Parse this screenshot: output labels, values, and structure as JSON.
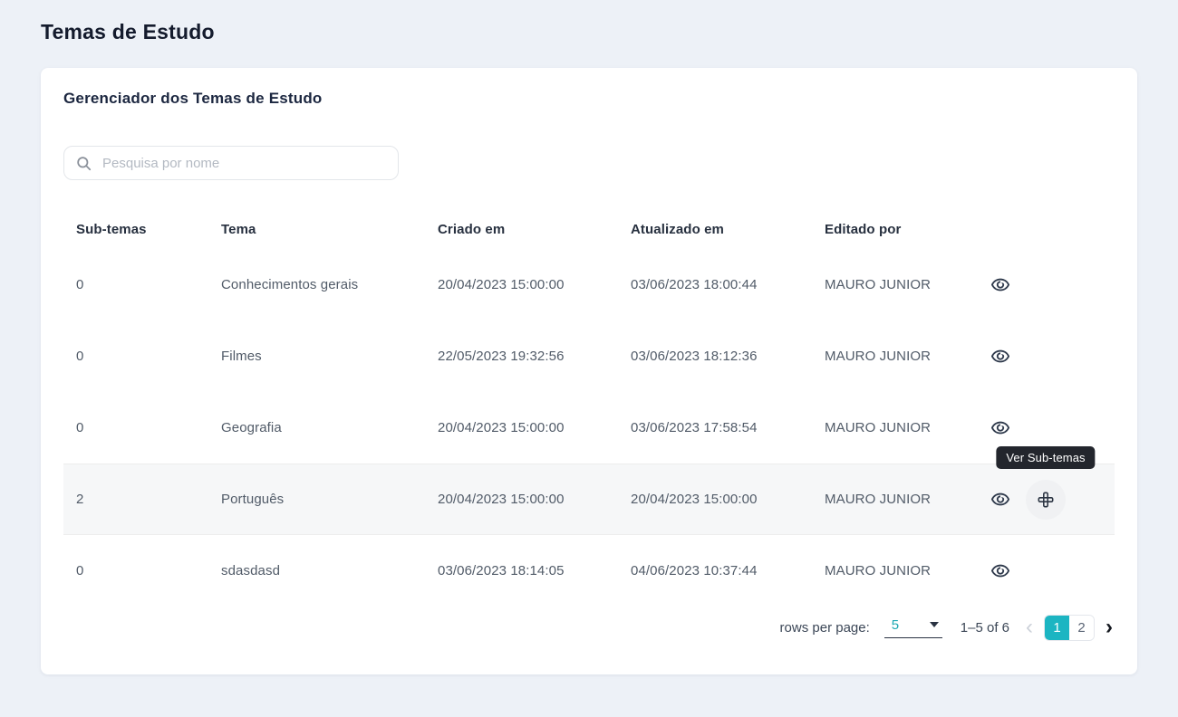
{
  "page": {
    "title": "Temas de Estudo"
  },
  "card": {
    "title": "Gerenciador dos Temas de Estudo"
  },
  "search": {
    "placeholder": "Pesquisa por nome",
    "value": ""
  },
  "table": {
    "columns": [
      "Sub-temas",
      "Tema",
      "Criado em",
      "Atualizado em",
      "Editado por"
    ],
    "rows": [
      {
        "subtemas": "0",
        "tema": "Conhecimentos gerais",
        "criado": "20/04/2023 15:00:00",
        "atualizado": "03/06/2023 18:00:44",
        "editado": "MAURO JUNIOR",
        "hovered": false
      },
      {
        "subtemas": "0",
        "tema": "Filmes",
        "criado": "22/05/2023 19:32:56",
        "atualizado": "03/06/2023 18:12:36",
        "editado": "MAURO JUNIOR",
        "hovered": false
      },
      {
        "subtemas": "0",
        "tema": "Geografia",
        "criado": "20/04/2023 15:00:00",
        "atualizado": "03/06/2023 17:58:54",
        "editado": "MAURO JUNIOR",
        "hovered": false
      },
      {
        "subtemas": "2",
        "tema": "Português",
        "criado": "20/04/2023 15:00:00",
        "atualizado": "20/04/2023 15:00:00",
        "editado": "MAURO JUNIOR",
        "hovered": true
      },
      {
        "subtemas": "0",
        "tema": "sdasdasd",
        "criado": "03/06/2023 18:14:05",
        "atualizado": "04/06/2023 10:37:44",
        "editado": "MAURO JUNIOR",
        "hovered": false
      }
    ],
    "icons": {
      "view": "eye-icon",
      "add_subtheme": "plus-interlock-icon"
    }
  },
  "tooltip": {
    "text": "Ver Sub-temas"
  },
  "pagination": {
    "rows_per_page_label": "rows per page:",
    "rows_per_page_value": "5",
    "range": "1–5 of 6",
    "pages": [
      "1",
      "2"
    ],
    "active_page": "1",
    "prev_icon": "chevron-left-icon",
    "next_icon": "chevron-right-icon"
  },
  "colors": {
    "accent_teal": "#1cb5c2",
    "tooltip_bg": "#23262d",
    "page_bg": "#edf1f7",
    "heading": "#141b2d"
  }
}
